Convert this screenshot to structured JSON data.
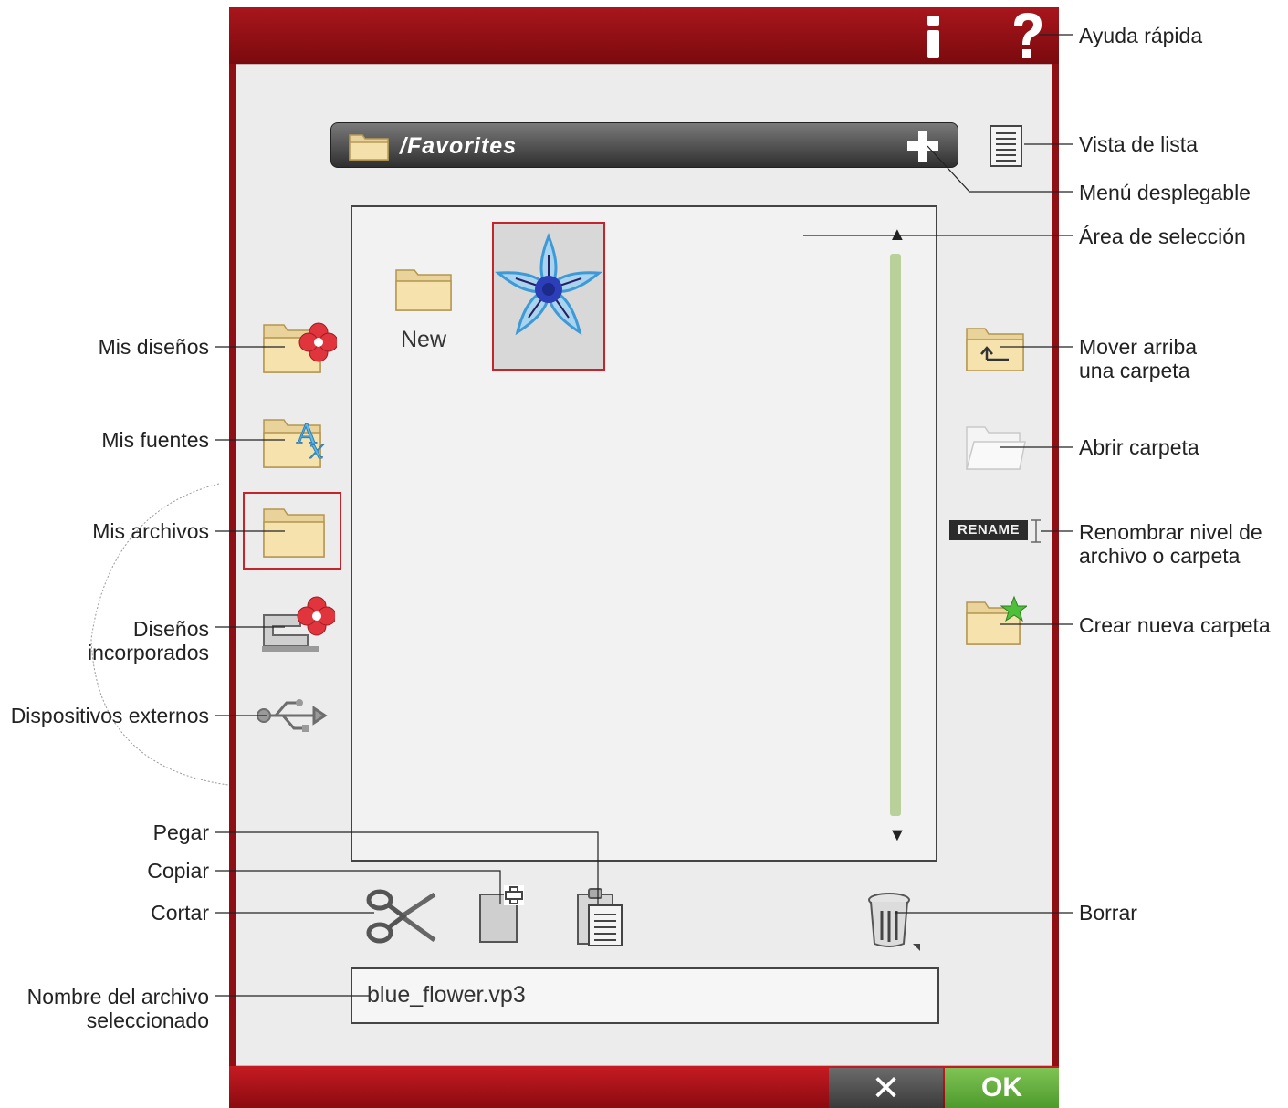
{
  "path_bar": {
    "path": "/Favorites"
  },
  "buttons": {
    "info": "i",
    "help": "?",
    "cancel": "✕",
    "ok": "OK",
    "rename": "RENAME"
  },
  "selection_area": {
    "items": [
      {
        "type": "folder",
        "label": "New"
      },
      {
        "type": "design",
        "label": ""
      }
    ]
  },
  "filename": "blue_flower.vp3",
  "labels": {
    "quick_help": "Ayuda rápida",
    "list_view": "Vista de lista",
    "dropdown_menu": "Menú desplegable",
    "selection_area": "Área de selección",
    "move_up_line1": "Mover arriba",
    "move_up_line2": "una carpeta",
    "open_folder": "Abrir carpeta",
    "rename_line1": "Renombrar nivel de",
    "rename_line2": "archivo o carpeta",
    "new_folder": "Crear nueva carpeta",
    "delete": "Borrar",
    "my_designs": "Mis diseños",
    "my_fonts": "Mis fuentes",
    "my_files": "Mis archivos",
    "builtin_line1": "Diseños",
    "builtin_line2": "incorporados",
    "external": "Dispositivos externos",
    "paste": "Pegar",
    "copy": "Copiar",
    "cut": "Cortar",
    "filename_line1": "Nombre del archivo",
    "filename_line2": "seleccionado"
  },
  "icons": {
    "my_designs": "folder-flower-icon",
    "my_fonts": "folder-font-icon",
    "my_files": "folder-icon",
    "builtin": "sewing-machine-icon",
    "external": "usb-icon",
    "move_up": "folder-up-icon",
    "open": "folder-open-icon",
    "new_folder": "folder-star-icon",
    "list_view": "list-view-icon",
    "cut": "scissors-icon",
    "copy": "copy-icon",
    "paste": "paste-icon",
    "delete": "trash-icon"
  },
  "colors": {
    "brand_red": "#8e0f14",
    "ok_green": "#5aa935",
    "selection_red": "#c4242b",
    "scroll_green": "#b8d09a"
  }
}
